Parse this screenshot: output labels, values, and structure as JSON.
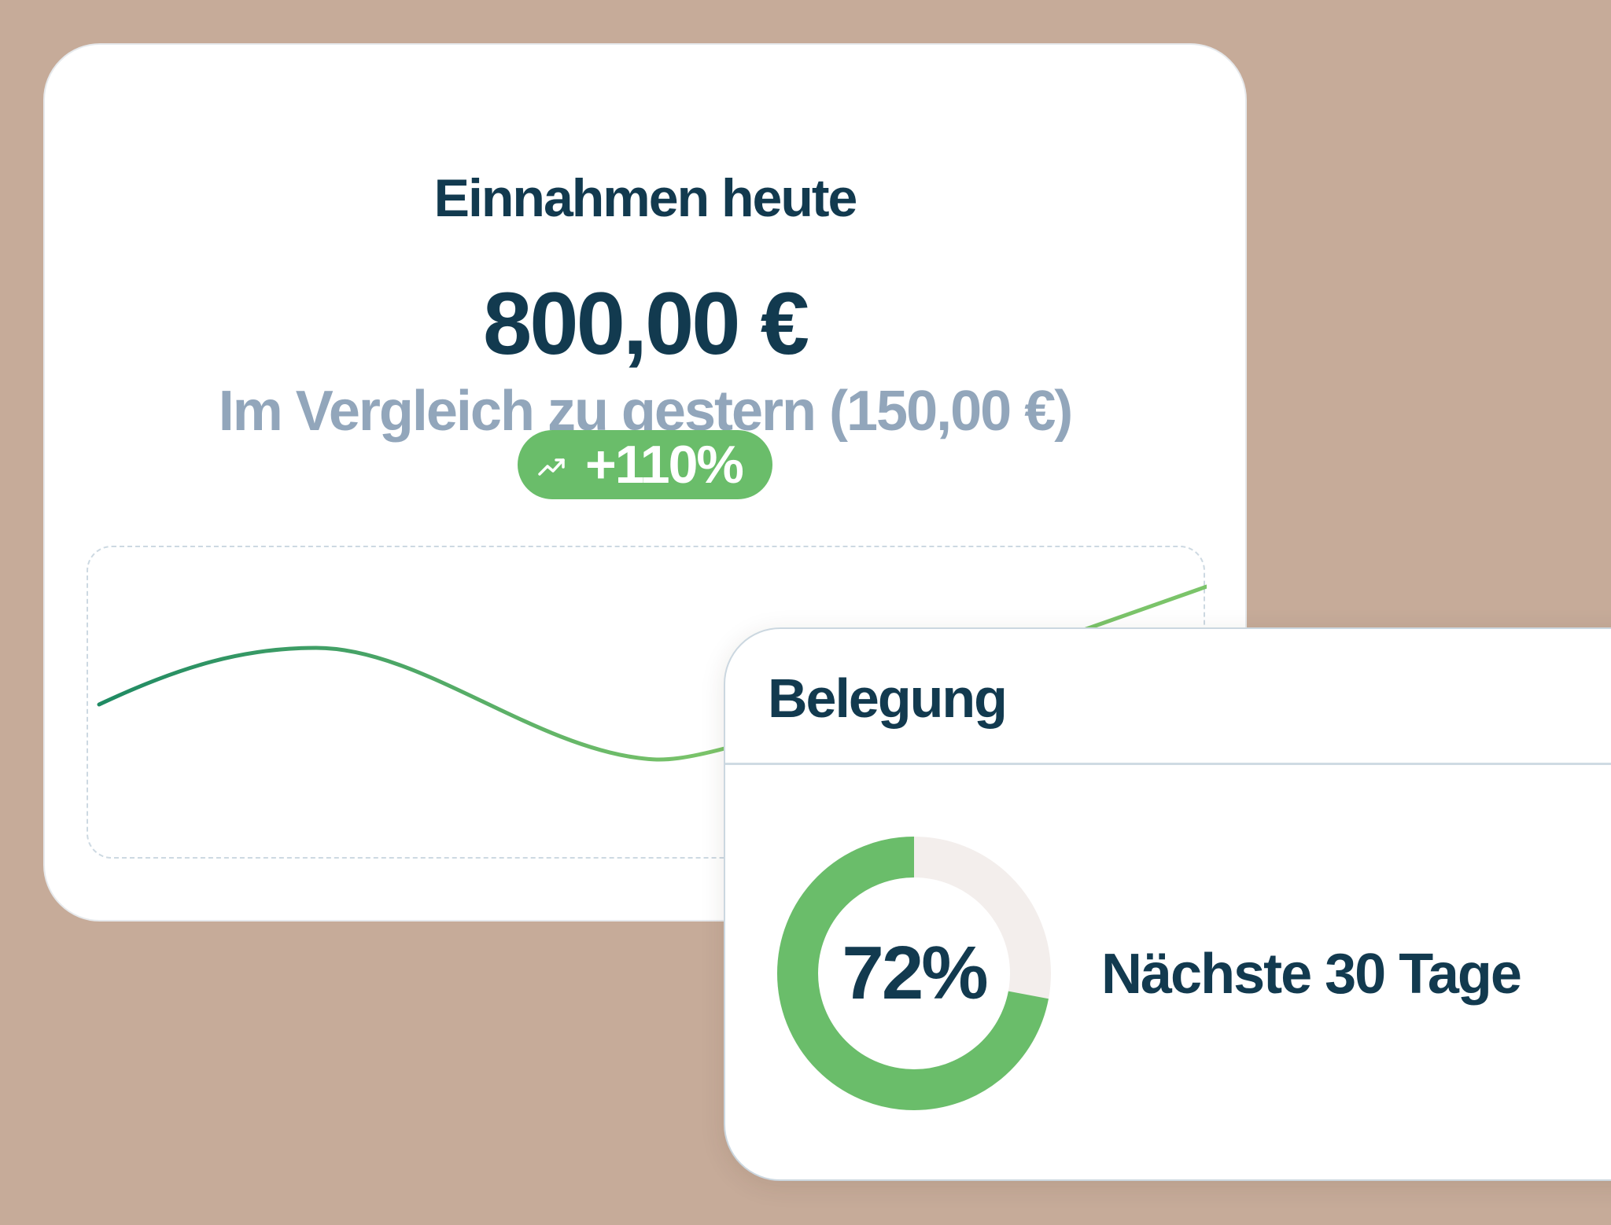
{
  "revenue_card": {
    "title": "Einnahmen heute",
    "amount": "800,00 €",
    "comparison": "Im Vergleich zu gestern (150,00 €)",
    "trend": {
      "label": "+110%",
      "icon": "trend-up-icon",
      "color": "#6abd6a"
    },
    "sparkline": {
      "stroke_start_color": "#1f8a63",
      "stroke_end_color": "#7bc46a"
    }
  },
  "occupancy_card": {
    "title": "Belegung",
    "percentage_label": "72%",
    "percentage_value": 72,
    "caption": "Nächste 30 Tage",
    "ring_color": "#6abd6a",
    "track_color": "#f3eeec"
  },
  "colors": {
    "background": "#c6ab99",
    "text_primary": "#123a4f",
    "text_secondary": "#92a6bb"
  }
}
